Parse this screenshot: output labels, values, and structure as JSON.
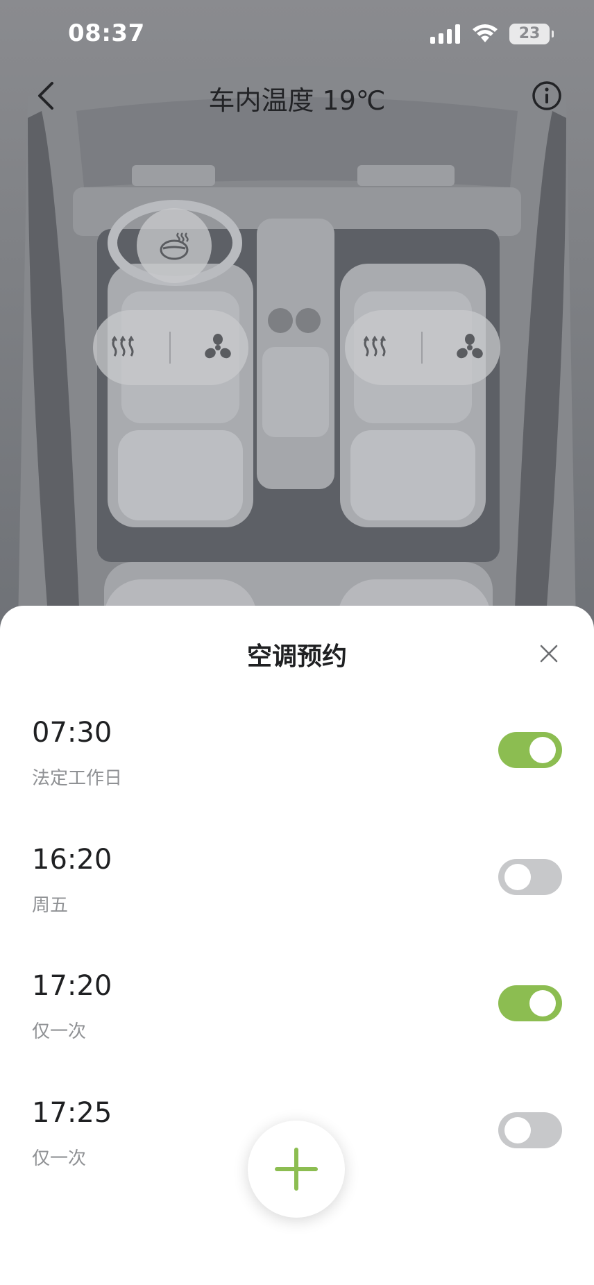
{
  "status_bar": {
    "time": "08:37",
    "battery": "23",
    "icons": [
      "signal-icon",
      "wifi-icon",
      "battery-icon"
    ]
  },
  "header": {
    "title": "车内温度 19℃",
    "back_icon": "chevron-left-icon",
    "info_icon": "info-icon"
  },
  "car_controls": {
    "steering_wheel_heat_icon": "steering-wheel-heat-icon",
    "seats": [
      {
        "position": "driver",
        "icons": [
          "seat-heat-icon",
          "seat-fan-icon"
        ]
      },
      {
        "position": "passenger",
        "icons": [
          "seat-heat-icon",
          "seat-fan-icon"
        ]
      }
    ]
  },
  "sheet": {
    "title": "空调预约",
    "close_icon": "close-icon",
    "schedules": [
      {
        "time": "07:30",
        "repeat": "法定工作日",
        "enabled": true
      },
      {
        "time": "16:20",
        "repeat": "周五",
        "enabled": false
      },
      {
        "time": "17:20",
        "repeat": "仅一次",
        "enabled": true
      },
      {
        "time": "17:25",
        "repeat": "仅一次",
        "enabled": false
      }
    ],
    "add_icon": "plus-icon"
  },
  "colors": {
    "accent": "#8cbd51",
    "toggle_off": "#c7c8ca",
    "overlay": "#7f8185"
  }
}
